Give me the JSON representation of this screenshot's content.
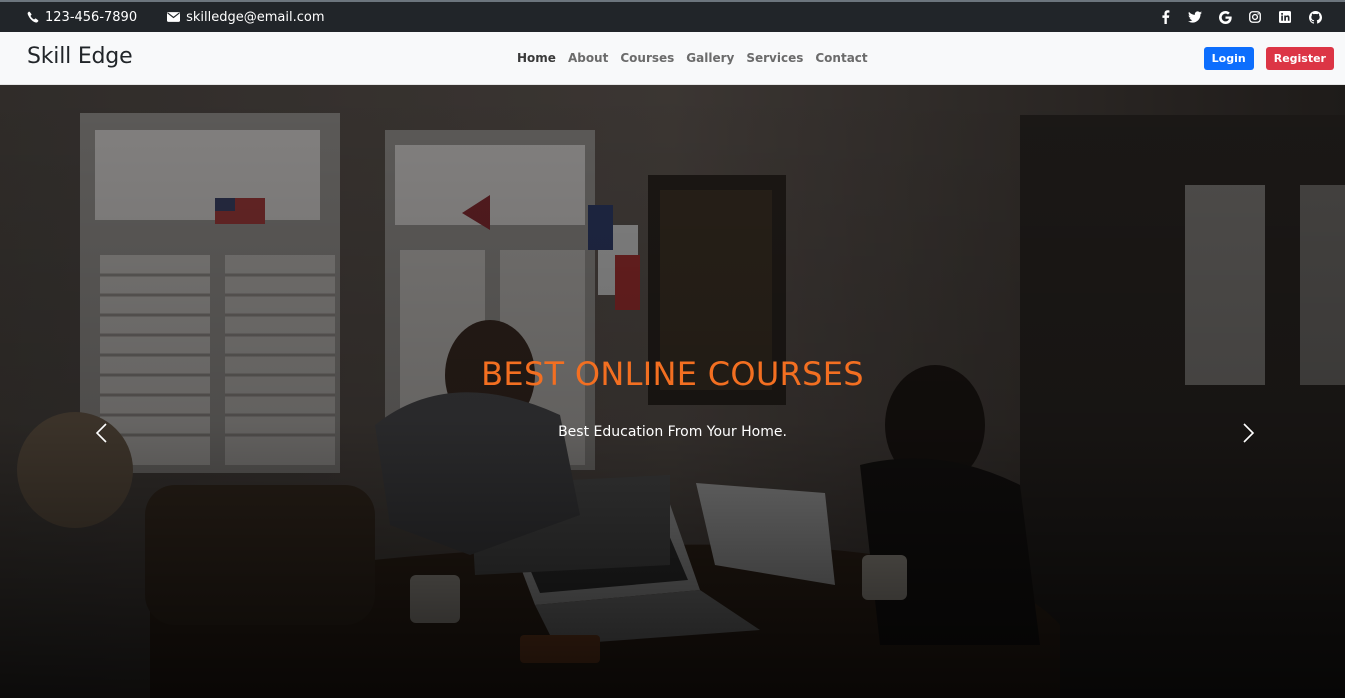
{
  "topbar": {
    "phone": "123-456-7890",
    "email": "skilledge@email.com",
    "socials": [
      "facebook-icon",
      "twitter-icon",
      "google-icon",
      "instagram-icon",
      "linkedin-icon",
      "github-icon"
    ]
  },
  "navbar": {
    "brand": "Skill Edge",
    "links": [
      "Home",
      "About",
      "Courses",
      "Gallery",
      "Services",
      "Contact"
    ],
    "active": "Home",
    "login_label": "Login",
    "register_label": "Register"
  },
  "hero": {
    "title": "BEST ONLINE COURSES",
    "subtitle": "Best Education From Your Home."
  },
  "colors": {
    "topbar_bg": "#212529",
    "navbar_bg": "#f8f9fa",
    "login": "#0d6efd",
    "register": "#dc3545",
    "hero_title": "#f36f21"
  }
}
